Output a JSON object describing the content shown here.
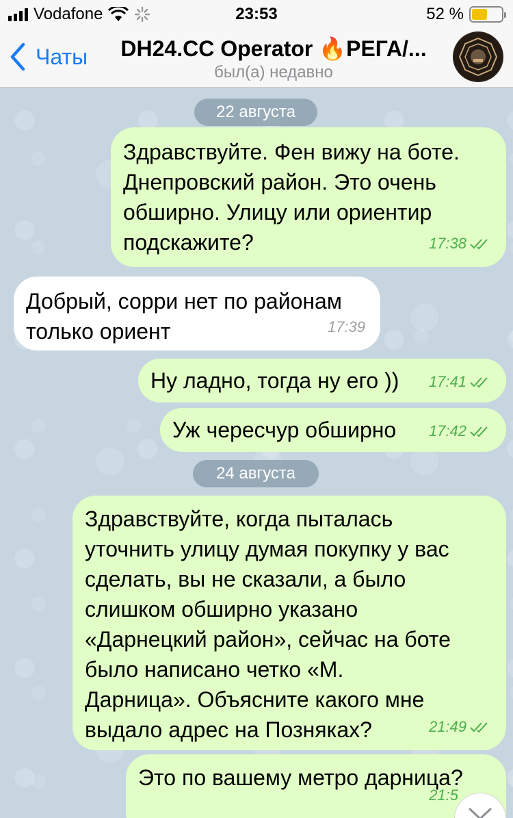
{
  "status_bar": {
    "carrier": "Vodafone",
    "time": "23:53",
    "battery": "52 %",
    "battery_level": 0.52
  },
  "header": {
    "back_label": "Чаты",
    "title": "DH24.CC Operator 🔥РЕГА/...",
    "subtitle": "был(а) недавно",
    "icons": [
      "chevron-left-icon",
      "avatar-logo"
    ]
  },
  "colors": {
    "outgoing_bubble": "#e1fec6",
    "incoming_bubble": "#ffffff",
    "accent": "#1a7cf5",
    "read_checks": "#4fae4e"
  },
  "dates": [
    "22 августа",
    "24 августа"
  ],
  "messages": [
    {
      "direction": "out",
      "lines": [
        "Здравствуйте. Фен вижу на боте.",
        "Днепровский район. Это очень",
        "обширно. Улицу или ориентир",
        "подскажите?"
      ],
      "time": "17:38"
    },
    {
      "direction": "in",
      "lines": [
        "Добрый, сорри нет по районам",
        "только ориент"
      ],
      "time": "17:39"
    },
    {
      "direction": "out",
      "lines": [
        "Ну ладно, тогда ну его ))"
      ],
      "time": "17:41"
    },
    {
      "direction": "out",
      "lines": [
        "Уж чересчур обширно"
      ],
      "time": "17:42"
    },
    {
      "direction": "out",
      "lines": [
        "Здравствуйте, когда пыталась",
        "уточнить улицу думая покупку у вас",
        "сделать, вы не сказали, а было",
        "слишком обширно указано",
        "«Дарнецкий район», сейчас на боте",
        "было написано четко «М.",
        "Дарница». Объясните какого мне",
        "выдало адрес на Позняках?"
      ],
      "time": "21:49"
    },
    {
      "direction": "out",
      "lines": [
        "Это по вашему метро дарница?"
      ],
      "time": "21:5"
    }
  ]
}
